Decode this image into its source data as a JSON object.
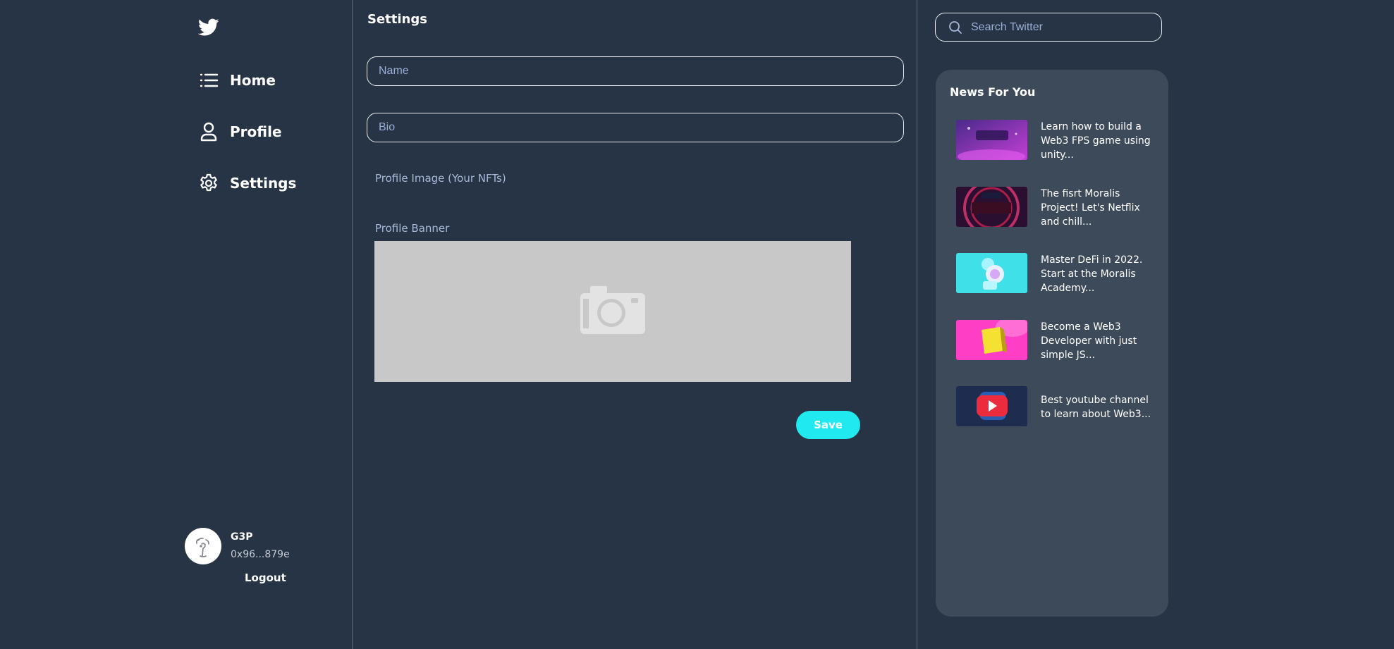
{
  "sidebar": {
    "nav": [
      {
        "label": "Home",
        "icon": "list-icon"
      },
      {
        "label": "Profile",
        "icon": "user-icon"
      },
      {
        "label": "Settings",
        "icon": "gear-icon"
      }
    ],
    "user": {
      "name": "G3P",
      "address": "0x96...879e",
      "logout_label": "Logout"
    }
  },
  "main": {
    "title": "Settings",
    "name_placeholder": "Name",
    "bio_placeholder": "Bio",
    "profile_image_label": "Profile Image (Your NFTs)",
    "profile_banner_label": "Profile Banner",
    "save_label": "Save"
  },
  "right": {
    "search_placeholder": "Search Twitter",
    "news_title": "News For You",
    "news": [
      {
        "text": "Learn how to build a Web3 FPS game using unity...",
        "thumb": "space-shooter-thumbnail"
      },
      {
        "text": "The fisrt Moralis Project! Let's Netflix and chill...",
        "thumb": "netflix-thumbnail"
      },
      {
        "text": "Master DeFi in 2022. Start at the Moralis Academy...",
        "thumb": "defi-thumbnail"
      },
      {
        "text": "Become a Web3 Developer with just simple JS...",
        "thumb": "javascript-thumbnail"
      },
      {
        "text": "Best youtube channel to learn about Web3...",
        "thumb": "youtube-thumbnail"
      }
    ]
  },
  "colors": {
    "background": "#273445",
    "panel": "#3d4a59",
    "accent": "#21e9f0",
    "placeholder": "#9aaed6",
    "banner_placeholder": "#c8c8c8"
  }
}
